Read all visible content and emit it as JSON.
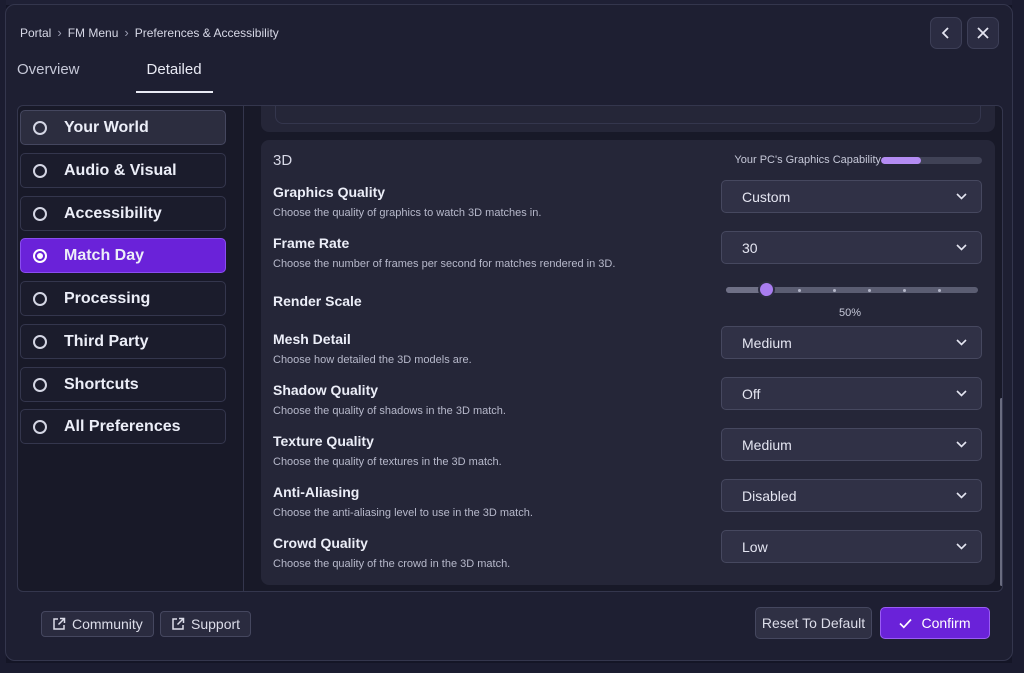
{
  "breadcrumb": [
    "Portal",
    "FM Menu",
    "Preferences & Accessibility"
  ],
  "tabs": [
    "Overview",
    "Detailed"
  ],
  "active_tab": "Detailed",
  "sidebar": {
    "items": [
      {
        "label": "Your World",
        "state": "hover"
      },
      {
        "label": "Audio & Visual",
        "state": "normal"
      },
      {
        "label": "Accessibility",
        "state": "normal"
      },
      {
        "label": "Match Day",
        "state": "selected"
      },
      {
        "label": "Processing",
        "state": "normal"
      },
      {
        "label": "Third Party",
        "state": "normal"
      },
      {
        "label": "Shortcuts",
        "state": "normal"
      },
      {
        "label": "All Preferences",
        "state": "normal"
      }
    ]
  },
  "section": {
    "title": "3D",
    "capability_label": "Your PC's Graphics Capability",
    "capability_level": 0.4,
    "settings": {
      "graphics_quality": {
        "title": "Graphics Quality",
        "desc": "Choose the quality of graphics to watch 3D matches in.",
        "value": "Custom"
      },
      "frame_rate": {
        "title": "Frame Rate",
        "desc": "Choose the number of frames per second for matches rendered in 3D.",
        "value": "30"
      },
      "render_scale": {
        "title": "Render Scale",
        "value_label": "50%",
        "value": 0.16
      },
      "mesh_detail": {
        "title": "Mesh Detail",
        "desc": "Choose how detailed the 3D models are.",
        "value": "Medium"
      },
      "shadow_quality": {
        "title": "Shadow Quality",
        "desc": "Choose the quality of shadows in the 3D match.",
        "value": "Off"
      },
      "texture_quality": {
        "title": "Texture Quality",
        "desc": "Choose the quality of textures in the 3D match.",
        "value": "Medium"
      },
      "anti_aliasing": {
        "title": "Anti-Aliasing",
        "desc": "Choose the anti-aliasing level to use in the 3D match.",
        "value": "Disabled"
      },
      "crowd_quality": {
        "title": "Crowd Quality",
        "desc": "Choose the quality of the crowd in the 3D match.",
        "value": "Low"
      }
    }
  },
  "footer": {
    "community": "Community",
    "support": "Support",
    "reset": "Reset To Default",
    "confirm": "Confirm"
  },
  "colors": {
    "accent": "#6a22d9",
    "accent_light": "#a97df0",
    "panel": "#252638",
    "background": "#1e1f32"
  },
  "icons": [
    "chevron-left-icon",
    "close-icon",
    "radio-icon",
    "chevron-down-icon",
    "external-link-icon",
    "check-icon"
  ]
}
